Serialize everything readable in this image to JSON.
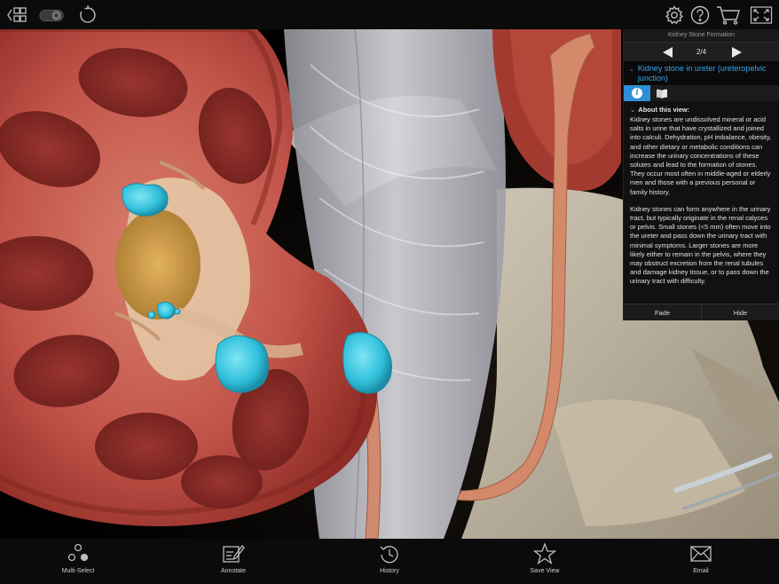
{
  "toolbar": {
    "icons": [
      "grid-menu-icon",
      "toggle-switch-icon",
      "reset-icon",
      "settings-icon",
      "help-icon",
      "cart-icon",
      "fullscreen-icon"
    ]
  },
  "panel": {
    "title": "Kidney Stone Formation",
    "page": "2/4",
    "view_title": "Kidney stone in ureter (ureteropelvic junction)",
    "about_heading": "About this view:",
    "paragraphs": [
      "Kidney stones are undissolved mineral or acid salts in urine that have crystallized and joined into calculi. Dehydration, pH imbalance, obesity, and other dietary or metabolic conditions can increase the urinary concentrations of these solutes and lead to the formation of stones. They occur most often in middle-aged or elderly men and those with a previous personal or family history.",
      "Kidney stones can form anywhere in the urinary tract, but typically originate in the renal calyces or pelvis. Small stones (<5 mm) often move into the ureter and pass down the urinary tract with minimal symptoms. Larger stones are more likely either to remain in the pelvis, where they may obstruct excretion from the renal tubules and damage kidney tissue, or to pass down the urinary tract with difficulty."
    ],
    "fade_label": "Fade",
    "hide_label": "Hide"
  },
  "bottombar": {
    "items": [
      {
        "label": "Multi-Select",
        "icon": "multi-select-icon"
      },
      {
        "label": "Annotate",
        "icon": "annotate-icon"
      },
      {
        "label": "History",
        "icon": "history-icon"
      },
      {
        "label": "Save View",
        "icon": "star-icon"
      },
      {
        "label": "Email",
        "icon": "email-icon"
      }
    ]
  },
  "colors": {
    "accent": "#2e8fd6",
    "title_blue": "#35a6e8",
    "stone": "#3ec6e0",
    "kidney": "#b5453a"
  }
}
